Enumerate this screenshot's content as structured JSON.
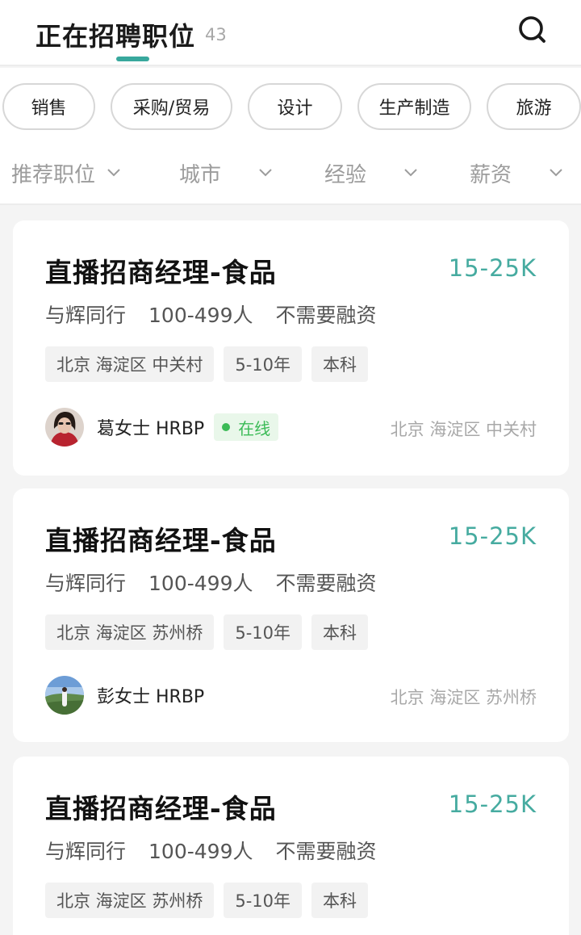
{
  "header": {
    "title": "正在招聘职位",
    "count": "43",
    "search_icon": "search-icon",
    "accent_color": "#38a89d"
  },
  "categories": [
    "销售",
    "采购/贸易",
    "设计",
    "生产制造",
    "旅游"
  ],
  "filters": [
    "推荐职位",
    "城市",
    "经验",
    "薪资"
  ],
  "jobs": [
    {
      "title": "直播招商经理-食品",
      "salary": "15-25K",
      "company": "与辉同行",
      "size": "100-499人",
      "funding": "不需要融资",
      "tags": [
        "北京 海淀区 中关村",
        "5-10年",
        "本科"
      ],
      "recruiter": "葛女士 HRBP",
      "online": "在线",
      "location": "北京 海淀区 中关村"
    },
    {
      "title": "直播招商经理-食品",
      "salary": "15-25K",
      "company": "与辉同行",
      "size": "100-499人",
      "funding": "不需要融资",
      "tags": [
        "北京 海淀区 苏州桥",
        "5-10年",
        "本科"
      ],
      "recruiter": "彭女士 HRBP",
      "location": "北京 海淀区 苏州桥"
    },
    {
      "title": "直播招商经理-食品",
      "salary": "15-25K",
      "company": "与辉同行",
      "size": "100-499人",
      "funding": "不需要融资",
      "tags": [
        "北京 海淀区 苏州桥",
        "5-10年",
        "本科"
      ]
    }
  ]
}
